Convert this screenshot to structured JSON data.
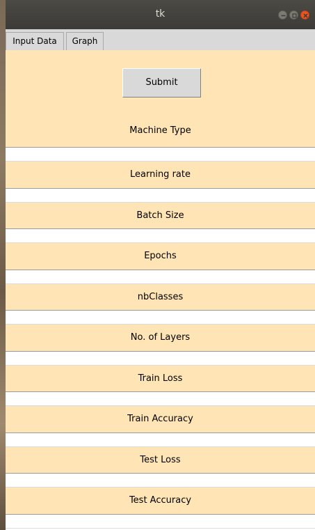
{
  "window": {
    "title": "tk"
  },
  "menu": {
    "tabs": [
      {
        "label": "Input Data"
      },
      {
        "label": "Graph"
      }
    ]
  },
  "form": {
    "submit_label": "Submit",
    "fields": [
      {
        "label": "Machine Type",
        "value": ""
      },
      {
        "label": "Learning rate",
        "value": ""
      },
      {
        "label": "Batch Size",
        "value": ""
      },
      {
        "label": "Epochs",
        "value": ""
      },
      {
        "label": "nbClasses",
        "value": ""
      },
      {
        "label": "No. of Layers",
        "value": ""
      },
      {
        "label": "Train Loss",
        "value": ""
      },
      {
        "label": "Train Accuracy",
        "value": ""
      },
      {
        "label": "Test Loss",
        "value": ""
      },
      {
        "label": "Test Accuracy",
        "value": ""
      }
    ]
  },
  "colors": {
    "panel_background": "#ffe4b5",
    "titlebar": "#3c3b37",
    "close_button": "#e95420"
  }
}
